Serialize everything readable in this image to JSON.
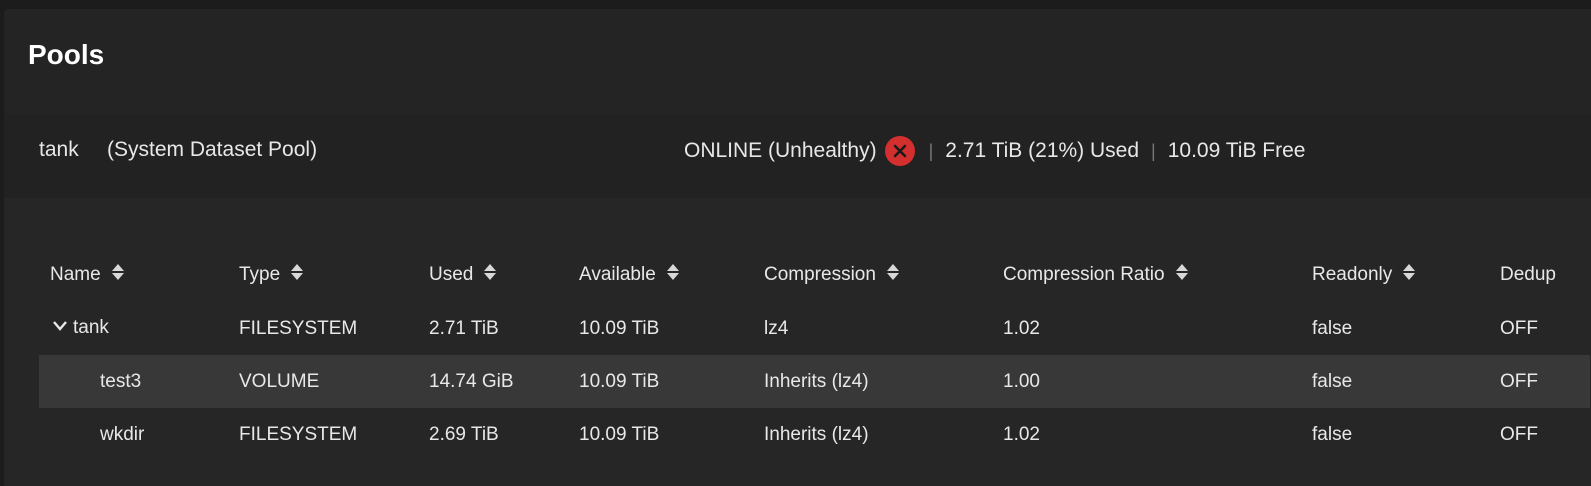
{
  "page": {
    "title": "Pools"
  },
  "pool": {
    "name": "tank",
    "tag": "(System Dataset Pool)",
    "status": "ONLINE (Unhealthy)",
    "status_icon": "error-circle-icon",
    "status_color": "#d32f2f",
    "used": "2.71 TiB (21%) Used",
    "free": "10.09 TiB Free",
    "separator": "|"
  },
  "table": {
    "headers": {
      "name": "Name",
      "type": "Type",
      "used": "Used",
      "available": "Available",
      "compression": "Compression",
      "ratio": "Compression Ratio",
      "readonly": "Readonly",
      "dedup": "Dedup"
    },
    "rows": [
      {
        "name": "tank",
        "type": "FILESYSTEM",
        "used": "2.71 TiB",
        "available": "10.09 TiB",
        "compression": "lz4",
        "ratio": "1.02",
        "readonly": "false",
        "dedup": "OFF"
      },
      {
        "name": "test3",
        "type": "VOLUME",
        "used": "14.74 GiB",
        "available": "10.09 TiB",
        "compression": "Inherits (lz4)",
        "ratio": "1.00",
        "readonly": "false",
        "dedup": "OFF"
      },
      {
        "name": "wkdir",
        "type": "FILESYSTEM",
        "used": "2.69 TiB",
        "available": "10.09 TiB",
        "compression": "Inherits (lz4)",
        "ratio": "1.02",
        "readonly": "false",
        "dedup": "OFF"
      }
    ]
  }
}
